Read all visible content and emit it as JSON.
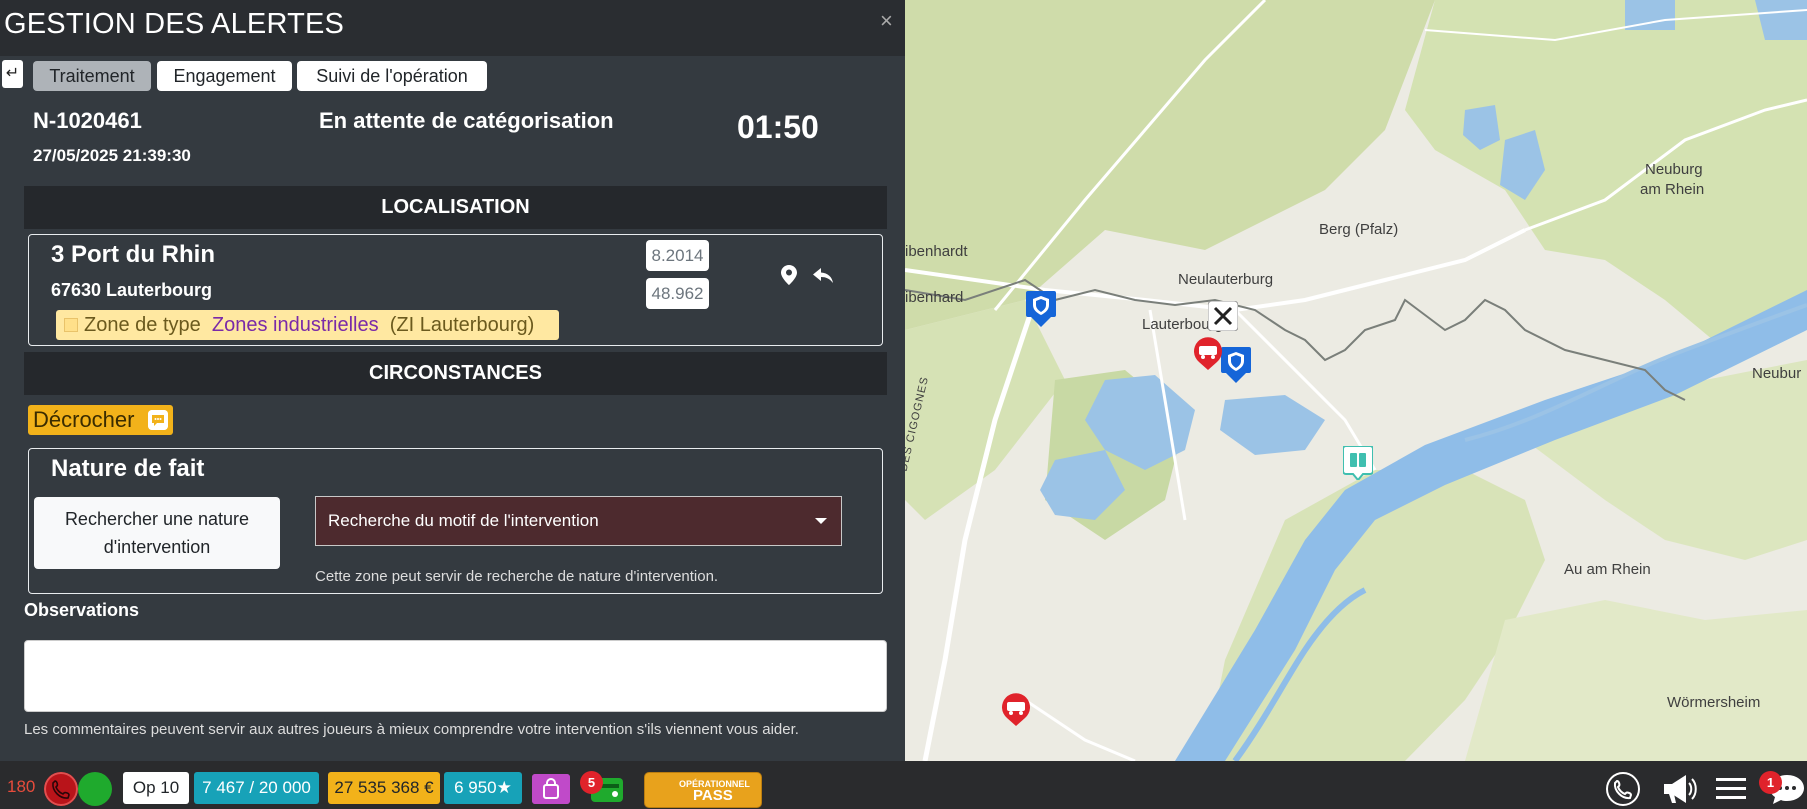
{
  "panel": {
    "title": "GESTION DES ALERTES",
    "close_label": "×",
    "back_label": "↵",
    "tabs": [
      {
        "label": "Traitement",
        "active": true
      },
      {
        "label": "Engagement",
        "active": false
      },
      {
        "label": "Suivi de l'opération",
        "active": false
      }
    ],
    "intervention_number": "N-1020461",
    "datetime": "27/05/2025 21:39:30",
    "status": "En attente de catégorisation",
    "timer": "01:50"
  },
  "location": {
    "section_title": "LOCALISATION",
    "address_line1": "3 Port du Rhin",
    "address_line2": "67630 Lauterbourg",
    "longitude": "8.2014",
    "latitude": "48.962",
    "zone_prefix": "Zone de type",
    "zone_type": "Zones industrielles",
    "zone_name": "(ZI Lauterbourg)"
  },
  "circumstances": {
    "section_title": "CIRCONSTANCES",
    "decrocher_label": "Décrocher",
    "nature_title": "Nature de fait",
    "search_nature_label": "Rechercher une nature d'intervention",
    "motif_placeholder": "Recherche du motif de l'intervention",
    "motif_help": "Cette zone peut servir de recherche de nature d'intervention.",
    "observations_label": "Observations",
    "observations_value": "",
    "observations_help": "Les commentaires peuvent servir aux autres joueurs à mieux comprendre votre intervention s'ils viennent vous aider."
  },
  "map": {
    "labels": [
      {
        "text": "ibenhardt"
      },
      {
        "text": "ibenhard"
      },
      {
        "text": "Neulauterburg"
      },
      {
        "text": "Lauterbourg"
      },
      {
        "text": "Berg (Pfalz)"
      },
      {
        "text": "Neuburg"
      },
      {
        "text": "am Rhein"
      },
      {
        "text": "Neubur"
      },
      {
        "text": "Au am Rhein"
      },
      {
        "text": "Wörmersheim"
      },
      {
        "text": "AUTOROUTE DES CIGOGNES"
      }
    ],
    "markers": [
      "police-marker",
      "police-marker",
      "fire-truck-marker",
      "fire-truck-marker",
      "tools-marker",
      "bus-stop-marker"
    ]
  },
  "bottombar": {
    "calls_count": "180",
    "operations": "Op 10",
    "missions": "7 467 / 20 000",
    "money": "27 535 368 €",
    "stars": "6 950",
    "wallet_badge": "5",
    "pass_line1": "OPÉRATIONNEL",
    "pass_line2": "PASS",
    "chat_badge": "1"
  },
  "colors": {
    "panel_bg": "#343a40",
    "section_header_bg": "#25282c",
    "accent_yellow": "#f2b21a",
    "accent_teal": "#17a2b8",
    "alert_red": "#e0232b",
    "status_green": "#1faa2d",
    "zone_bg": "#ffe8a1",
    "motif_bg": "#4d2a2e"
  }
}
